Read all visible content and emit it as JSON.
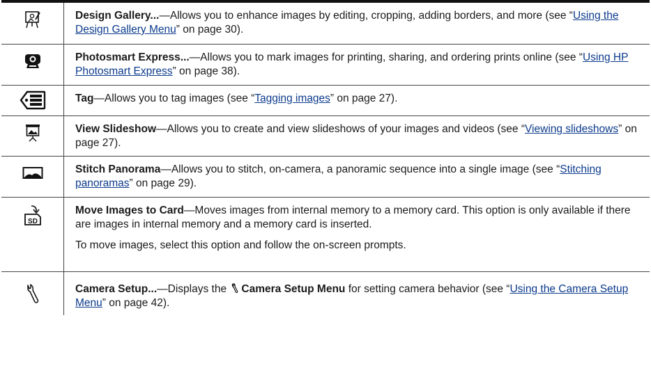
{
  "rows": [
    {
      "icon": "design-gallery-icon",
      "title": "Design Gallery...",
      "pre": "—Allows you to enhance images by editing, cropping, adding borders, and more (see “",
      "link": "Using the Design Gallery Menu",
      "post": "” on page 30)."
    },
    {
      "icon": "photosmart-express-icon",
      "title": "Photosmart Express...",
      "pre": "—Allows you to mark images for printing, sharing, and ordering prints online (see “",
      "link": "Using HP Photosmart Express",
      "post": "” on page 38)."
    },
    {
      "icon": "tag-icon",
      "title": "Tag",
      "pre": "—Allows you to tag images (see “",
      "link": "Tagging images",
      "post": "” on page 27)."
    },
    {
      "icon": "slideshow-icon",
      "title": "View Slideshow",
      "pre": "—Allows you to create and view slideshows of your images and videos (see “",
      "link": "Viewing slideshows",
      "post": "” on page 27)."
    },
    {
      "icon": "panorama-icon",
      "title": "Stitch Panorama",
      "pre": "—Allows you to stitch, on-camera, a panoramic sequence into a single image (see “",
      "link": "Stitching panoramas",
      "post": "” on page 29)."
    },
    {
      "icon": "move-to-card-icon",
      "title": "Move Images to Card",
      "text": "—Moves images from internal memory to a memory card. This option is only available if there are images in internal memory and a memory card is inserted.",
      "extra": "To move images, select this option and follow the on-screen prompts.",
      "badge": "SD"
    },
    {
      "icon": "wrench-icon",
      "title": "Camera Setup...",
      "pre_a": "—Displays the ",
      "menu": "Camera Setup Menu",
      "pre_b": " for setting camera behavior (see “",
      "link": "Using the Camera Setup Menu",
      "post": "” on page 42)."
    }
  ]
}
